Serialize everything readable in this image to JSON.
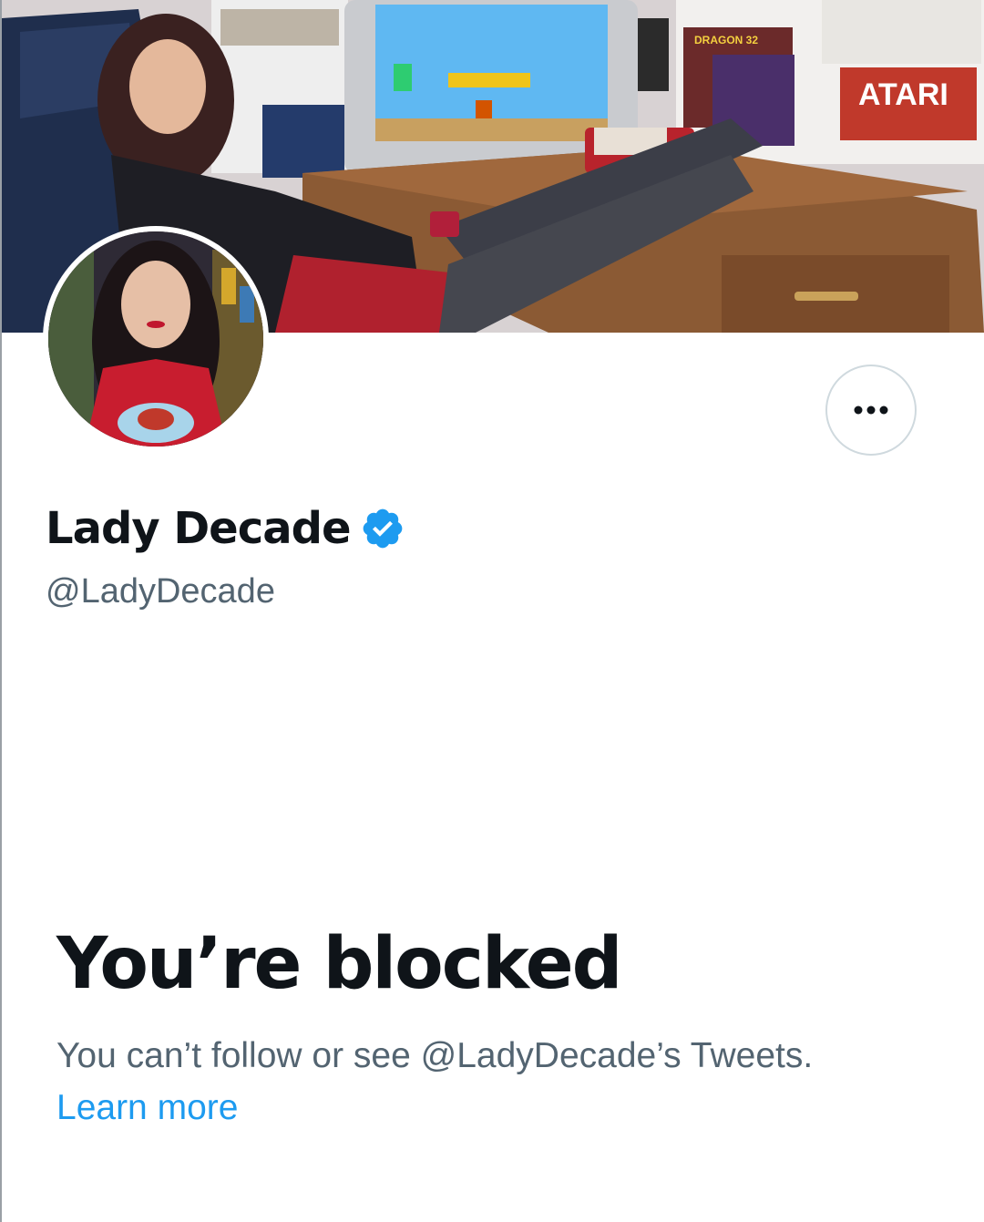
{
  "profile": {
    "display_name": "Lady Decade",
    "handle": "@LadyDecade",
    "verified": true,
    "verified_color": "#1d9bf0"
  },
  "banner": {
    "brand_sign": "ATARI",
    "box_label": "DRAGON 32"
  },
  "more_button": {
    "icon": "more-horizontal-icon"
  },
  "blocked": {
    "title": "You’re blocked",
    "message": "You can’t follow or see @LadyDecade’s Tweets.",
    "learn_more": "Learn more",
    "link_color": "#1d9bf0"
  }
}
